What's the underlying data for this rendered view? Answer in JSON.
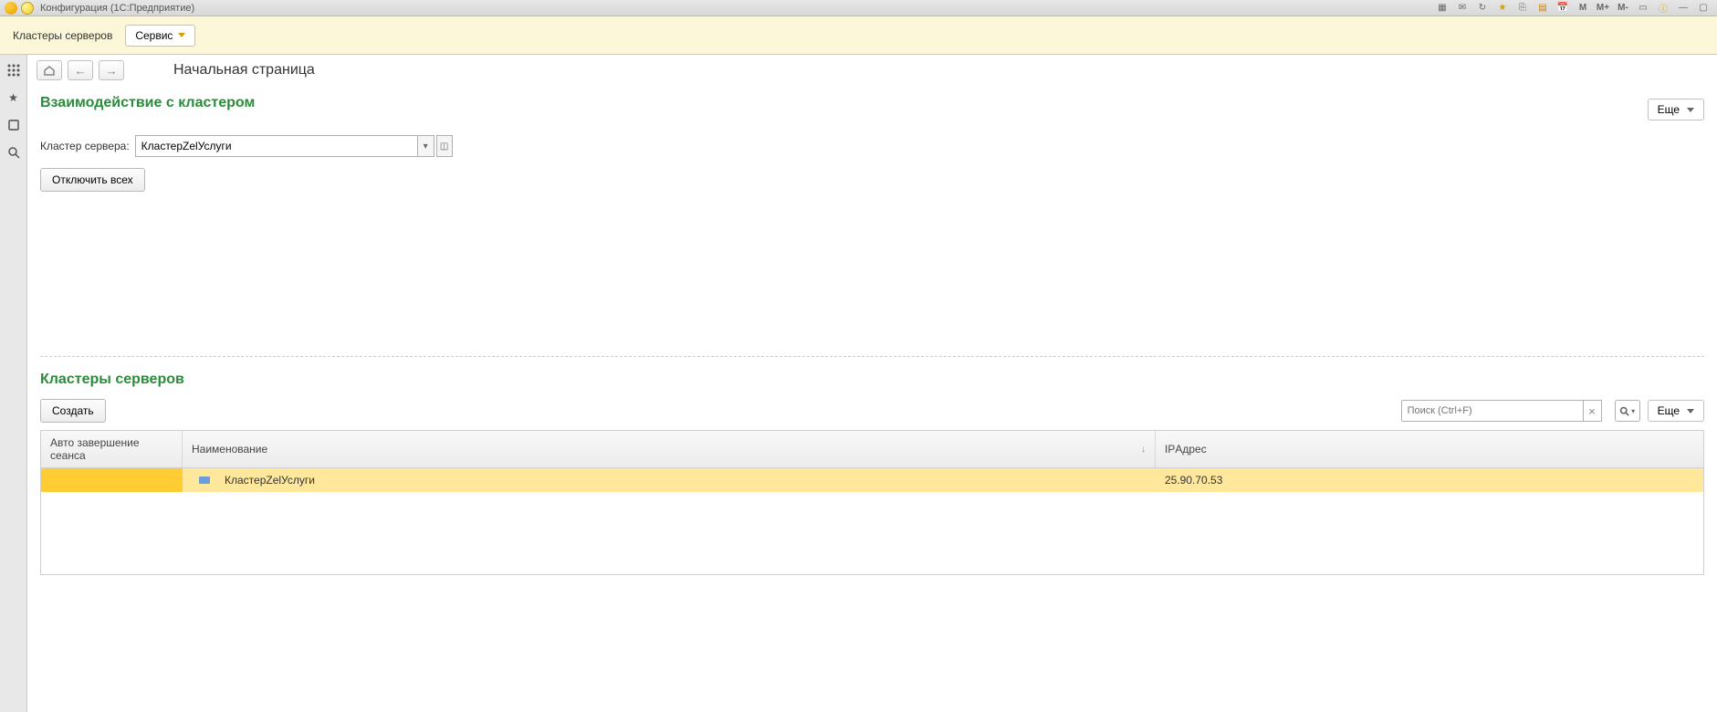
{
  "titlebar": {
    "title": "Конфигурация  (1С:Предприятие)"
  },
  "toolbar": {
    "clusters_label": "Кластеры серверов",
    "service_label": "Сервис"
  },
  "page": {
    "title": "Начальная страница"
  },
  "interaction": {
    "title": "Взаимодействие с кластером",
    "more_label": "Еще",
    "cluster_label": "Кластер сервера:",
    "cluster_value": "КластерZelУслуги",
    "disconnect_label": "Отключить всех"
  },
  "clusters": {
    "title": "Кластеры серверов",
    "create_label": "Создать",
    "search_placeholder": "Поиск (Ctrl+F)",
    "more_label": "Еще",
    "columns": {
      "auto": "Авто завершение сеанса",
      "name": "Наименование",
      "ip": "IPАдрес",
      "sort": "↓"
    },
    "rows": [
      {
        "auto": "",
        "name": "КластерZelУслуги",
        "ip": "25.90.70.53"
      }
    ]
  },
  "m_buttons": {
    "m": "M",
    "mplus": "M+",
    "mminus": "M-"
  }
}
